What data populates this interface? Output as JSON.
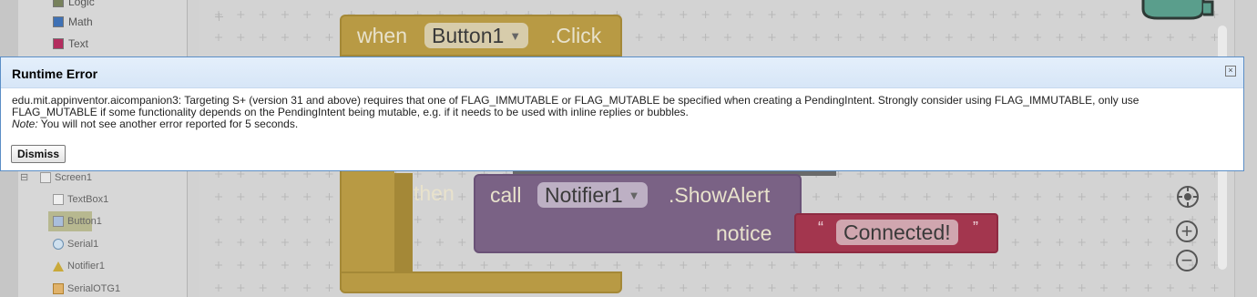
{
  "palette": {
    "items": [
      {
        "label": "Logic",
        "color": "#77815c"
      },
      {
        "label": "Math",
        "color": "#3f71b5"
      },
      {
        "label": "Text",
        "color": "#b32d5e"
      }
    ]
  },
  "tree": {
    "collapse_symbol": "⊟",
    "root": "Screen1",
    "children": [
      "TextBox1",
      "Button1",
      "Serial1",
      "Notifier1",
      "SerialOTG1"
    ]
  },
  "blocks": {
    "event": {
      "when_label": "when",
      "component": "Button1",
      "event_name": ".Click",
      "then_label": "then"
    },
    "call": {
      "call_label": "call",
      "component": "Notifier1",
      "method": ".ShowAlert",
      "param_label": "notice"
    },
    "string": {
      "open_quote": "“",
      "value": "Connected!",
      "close_quote": "”"
    }
  },
  "zoom": {
    "center_icon": "target-icon",
    "zoom_in": "+",
    "zoom_out": "−"
  },
  "dialog": {
    "title": "Runtime Error",
    "message": "edu.mit.appinventor.aicompanion3: Targeting S+ (version 31 and above) requires that one of FLAG_IMMUTABLE or FLAG_MUTABLE be specified when creating a PendingIntent. Strongly consider using FLAG_IMMUTABLE, only use FLAG_MUTABLE if some functionality depends on the PendingIntent being mutable, e.g. if it needs to be used with inline replies or bubbles.",
    "note_label": "Note:",
    "note_text": " You will not see another error reported for 5 seconds.",
    "dismiss_label": "Dismiss",
    "close_symbol": "×"
  },
  "colors": {
    "event_block": "#b89a44",
    "call_block": "#7a6285",
    "string_block": "#a3364e",
    "dialog_border": "#5b8ec6"
  }
}
